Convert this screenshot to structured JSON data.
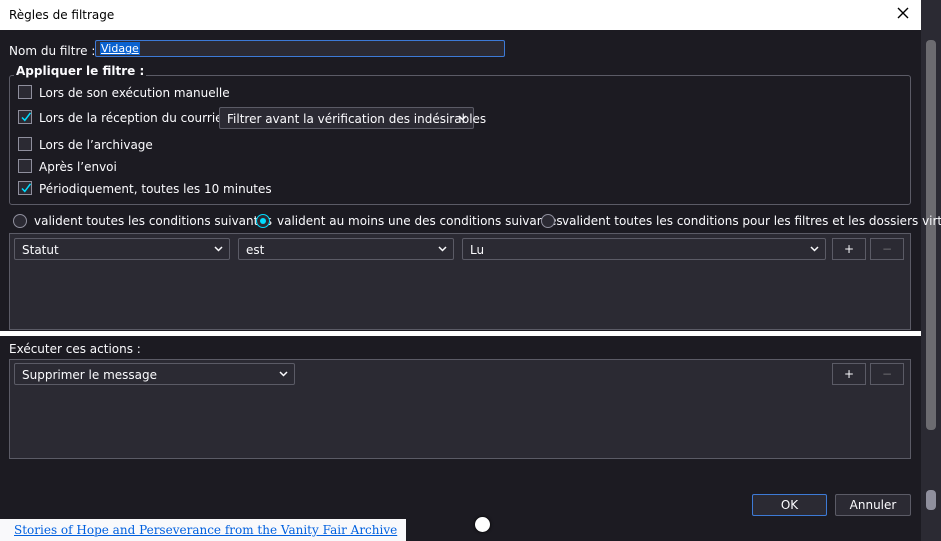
{
  "window": {
    "title": "Règles de filtrage"
  },
  "filter_name": {
    "label": "Nom du filtre :",
    "value": "Vidage"
  },
  "apply": {
    "legend": "Appliquer le filtre :",
    "options": [
      {
        "label": "Lors de son exécution manuelle",
        "checked": false
      },
      {
        "label": "Lors de la réception du courrier :",
        "checked": true
      },
      {
        "label": "Lors de l’archivage",
        "checked": false
      },
      {
        "label": "Après l’envoi",
        "checked": false
      },
      {
        "label": "Périodiquement, toutes les 10 minutes",
        "checked": true
      }
    ],
    "reception_select": "Filtrer avant la vérification des indésirables"
  },
  "match": {
    "options": [
      {
        "label": "valident toutes les conditions suivantes",
        "selected": false
      },
      {
        "label": "valident au moins une des conditions suivantes",
        "selected": true
      },
      {
        "label": "valident toutes les conditions pour les filtres et les dossiers virtuels",
        "selected": false
      }
    ]
  },
  "condition": {
    "field": "Statut",
    "operator": "est",
    "value": "Lu",
    "add": "+",
    "remove": "−"
  },
  "actions": {
    "label": "Exécuter ces actions :",
    "action": "Supprimer le message",
    "add": "+",
    "remove": "−"
  },
  "buttons": {
    "ok": "OK",
    "cancel": "Annuler"
  },
  "background": {
    "link": "Stories of Hope and Perseverance from the Vanity Fair Archive"
  },
  "colors": {
    "accent": "#00ddff",
    "focus": "#3d7ad6",
    "bg": "#1c1b22",
    "field": "#2b2a33"
  }
}
